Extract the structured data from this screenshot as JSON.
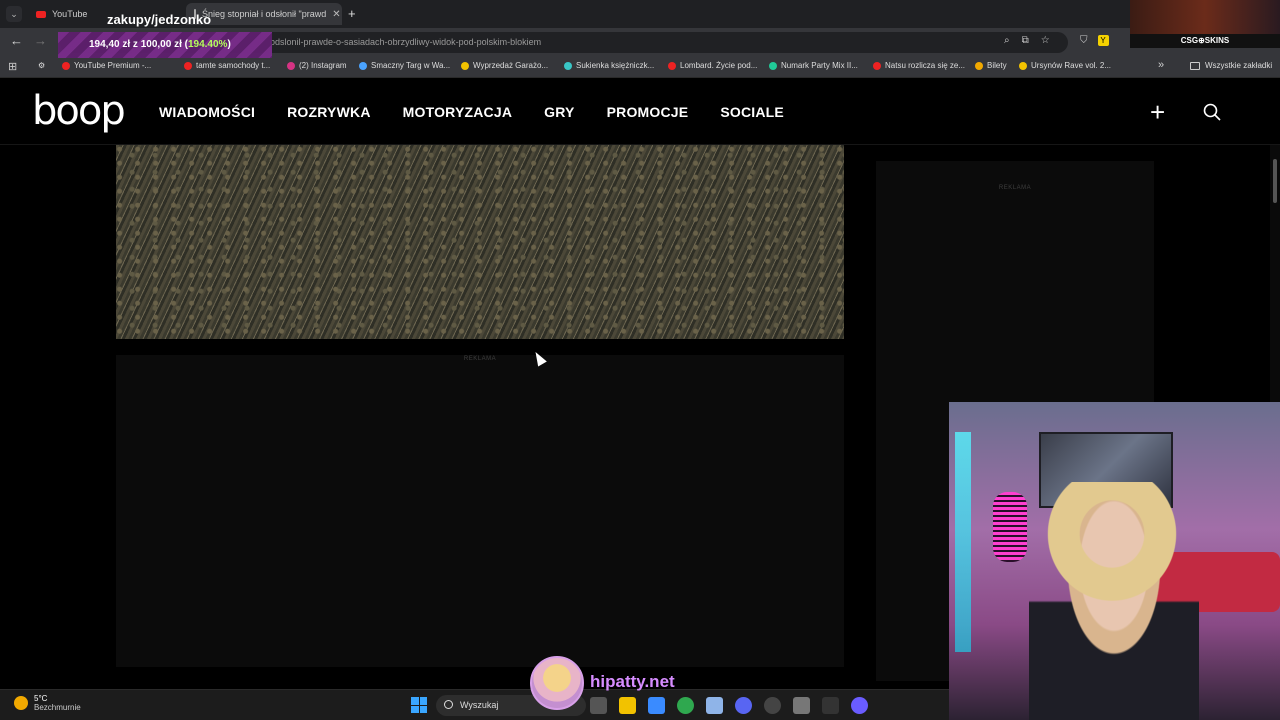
{
  "browser": {
    "tabs": [
      {
        "label": "YouTube"
      },
      {
        "label": "Śnieg stopniał i odsłonił \"prawd"
      }
    ],
    "url": "odslonil-prawde-o-sasiadach-obrzydliwy-widok-pod-polskim-blokiem"
  },
  "bookmarks": [
    {
      "label": "YouTube Premium -...",
      "color": "#e22"
    },
    {
      "label": "tamte samochody t...",
      "color": "#e22"
    },
    {
      "label": "(2) Instagram",
      "color": "#d63384"
    },
    {
      "label": "Smaczny Targ w Wa...",
      "color": "#4aa3ff"
    },
    {
      "label": "Wyprzedaż Garażo...",
      "color": "#f2c200"
    },
    {
      "label": "Sukienka księżniczk...",
      "color": "#39c6c6"
    },
    {
      "label": "Lombard. Życie pod...",
      "color": "#e22"
    },
    {
      "label": "Numark Party Mix II...",
      "color": "#20c997"
    },
    {
      "label": "Natsu rozlicza się ze...",
      "color": "#e22"
    },
    {
      "label": "Bilety",
      "color": "#f2a900"
    },
    {
      "label": "Ursynów Rave vol. 2...",
      "color": "#f2c200"
    }
  ],
  "bookmarks_all": "Wszystkie zakładki",
  "overlay": {
    "title": "zakupy/jedzonko",
    "amount_prefix": "194,40 zł z 100,00 zł (",
    "amount_pct": "194.40%",
    "amount_suffix": ")"
  },
  "promo": {
    "label": "CSG⊕SKINS"
  },
  "site": {
    "logo": "boop",
    "nav": [
      "WIADOMOŚCI",
      "ROZRYWKA",
      "MOTORYZACJA",
      "GRY",
      "PROMOCJE",
      "SOCIALE"
    ]
  },
  "ads": {
    "label": "REKLAMA"
  },
  "taskbar": {
    "weather_temp": "5°C",
    "weather_desc": "Bezchmurnie",
    "search_placeholder": "Wyszukaj"
  },
  "brand": {
    "text": "hipatty.net"
  }
}
